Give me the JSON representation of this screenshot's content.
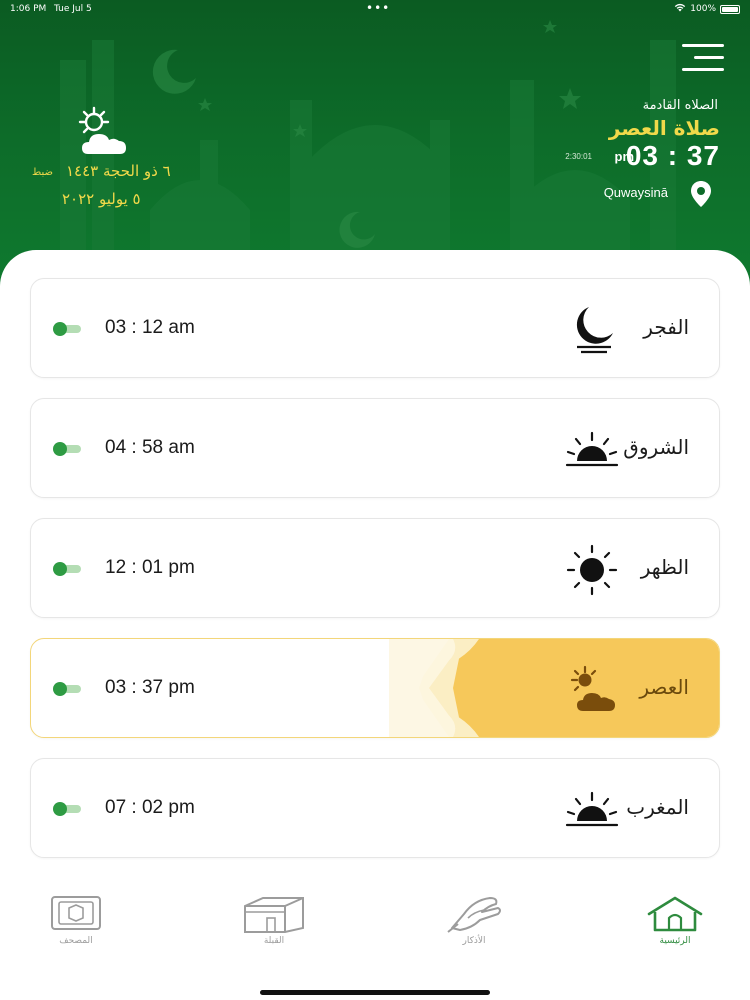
{
  "status_bar": {
    "time": "1:06 PM",
    "date": "Tue Jul 5",
    "dots": "•••",
    "battery": "100%"
  },
  "header": {
    "menu_icon": "hamburger-icon",
    "next_prayer_label": "الصلاه القادمة",
    "next_prayer_name": "صلاة العصر",
    "next_prayer_time": "03 : 37",
    "next_prayer_ampm": "pm",
    "countdown": "2:30:01",
    "location": "Quwaysinā",
    "location_icon": "location-pin-icon",
    "weather_icon": "sun-cloud-icon",
    "hijri_date": "٦ ذو الحجة ١٤٤٣",
    "adjust_label": "ضبط",
    "gregorian_date": "٥ يوليو ٢٠٢٢"
  },
  "prayers": [
    {
      "name": "الفجر",
      "time": "03 : 12  am",
      "icon": "crescent-moon-icon",
      "active": false
    },
    {
      "name": "الشروق",
      "time": "04 : 58  am",
      "icon": "sunrise-icon",
      "active": false
    },
    {
      "name": "الظهر",
      "time": "12 : 01  pm",
      "icon": "sun-icon",
      "active": false
    },
    {
      "name": "العصر",
      "time": "03 : 37  pm",
      "icon": "sun-cloud-icon",
      "active": true
    },
    {
      "name": "المغرب",
      "time": "07 : 02  pm",
      "icon": "sunset-icon",
      "active": false
    }
  ],
  "tabs": [
    {
      "label": "المصحف",
      "icon": "quran-book-icon",
      "active": false
    },
    {
      "label": "القبلة",
      "icon": "kaaba-icon",
      "active": false
    },
    {
      "label": "الأذكار",
      "icon": "praying-hands-icon",
      "active": false
    },
    {
      "label": "الرئيسية",
      "icon": "home-icon",
      "active": true
    }
  ],
  "colors": {
    "header_green": "#0d6b29",
    "accent_yellow": "#f1d94a",
    "active_band": "#f6c85a",
    "toggle_green": "#2e9b43",
    "tab_active": "#2e8b3e"
  }
}
